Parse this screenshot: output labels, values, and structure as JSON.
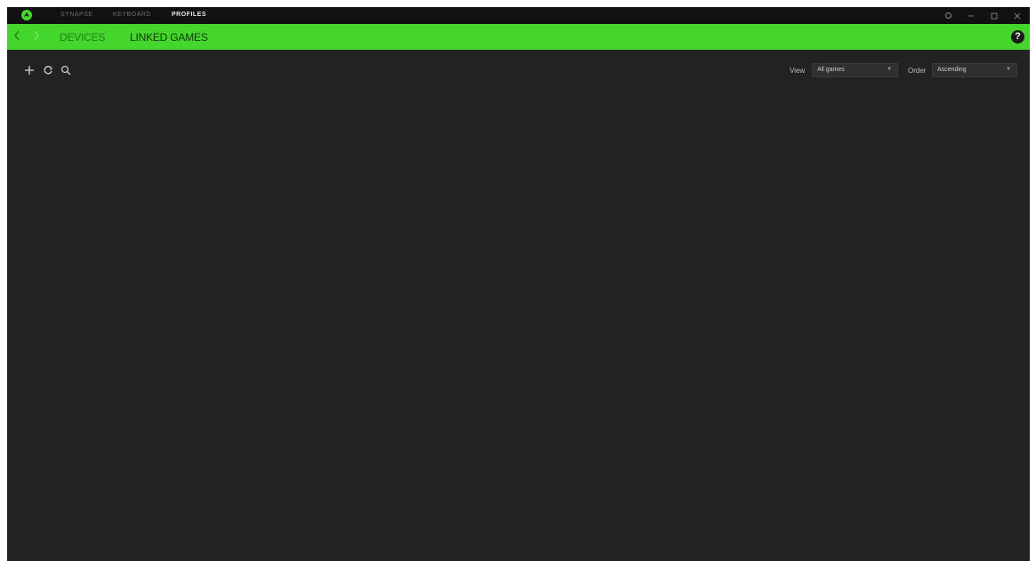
{
  "titlebar": {
    "tabs": [
      {
        "label": "SYNAPSE",
        "active": false
      },
      {
        "label": "KEYBOARD",
        "active": false
      },
      {
        "label": "PROFILES",
        "active": true
      }
    ],
    "controls": [
      "settings-icon",
      "minimize-icon",
      "maximize-icon",
      "close-icon"
    ]
  },
  "subnav": {
    "tabs": [
      {
        "label": "DEVICES",
        "active": false
      },
      {
        "label": "LINKED GAMES",
        "active": true
      }
    ],
    "help_label": "?"
  },
  "toolbar": {
    "icons": [
      "add-icon",
      "refresh-icon",
      "search-icon"
    ],
    "view_label": "View",
    "view_value": "All games",
    "order_label": "Order",
    "order_value": "Ascending"
  },
  "colors": {
    "brand_green": "#44d62c",
    "background": "#222222",
    "titlebar": "#111111"
  }
}
